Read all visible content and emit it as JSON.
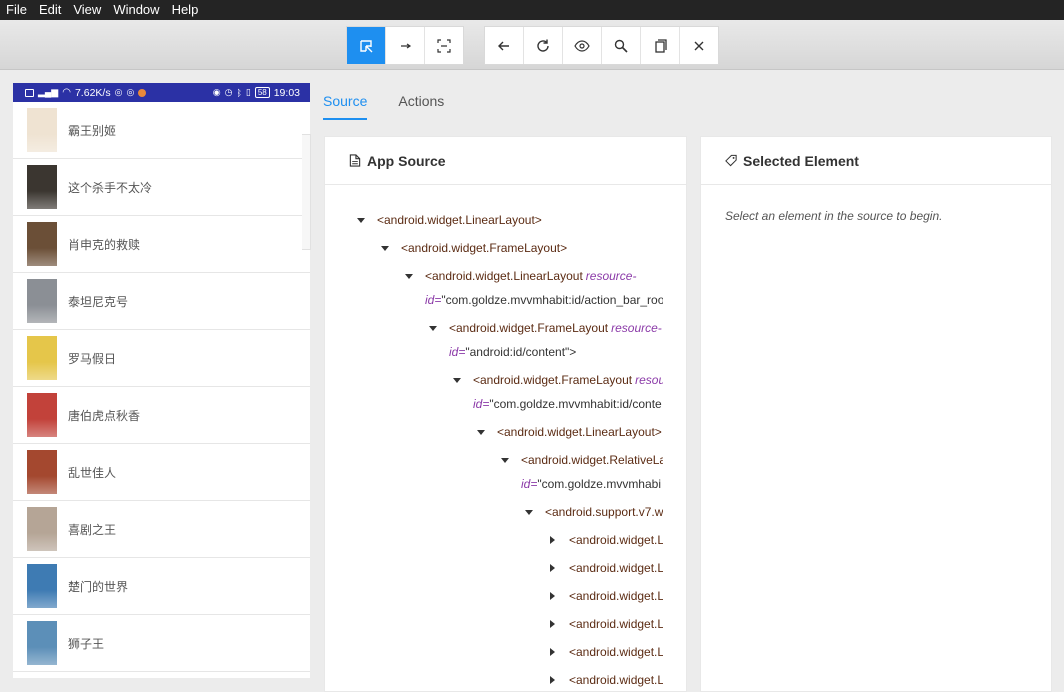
{
  "menu": [
    "File",
    "Edit",
    "View",
    "Window",
    "Help"
  ],
  "toolbar": {
    "left_group": [
      {
        "icon": "select-icon",
        "active": true
      },
      {
        "icon": "swipe-icon",
        "active": false
      },
      {
        "icon": "tap-coordinates-icon",
        "active": false
      }
    ],
    "right_group": [
      {
        "icon": "back-icon"
      },
      {
        "icon": "refresh-icon"
      },
      {
        "icon": "eye-icon"
      },
      {
        "icon": "search-icon"
      },
      {
        "icon": "copy-icon"
      },
      {
        "icon": "close-icon"
      }
    ]
  },
  "device": {
    "status_bar": {
      "network_speed": "7.62K/s",
      "battery": "58",
      "time": "19:03"
    },
    "movies": [
      {
        "title": "霸王别姬",
        "poster_color": "#efe3d2"
      },
      {
        "title": "这个杀手不太冷",
        "poster_color": "#3b3630"
      },
      {
        "title": "肖申克的救赎",
        "poster_color": "#6b4f37"
      },
      {
        "title": "泰坦尼克号",
        "poster_color": "#8b8f95"
      },
      {
        "title": "罗马假日",
        "poster_color": "#e5c64a"
      },
      {
        "title": "唐伯虎点秋香",
        "poster_color": "#c2423a"
      },
      {
        "title": "乱世佳人",
        "poster_color": "#a4482f"
      },
      {
        "title": "喜剧之王",
        "poster_color": "#b5a596"
      },
      {
        "title": "楚门的世界",
        "poster_color": "#3e7bb3"
      },
      {
        "title": "狮子王",
        "poster_color": "#5c8fb8"
      }
    ]
  },
  "tabs": [
    {
      "label": "Source",
      "active": true
    },
    {
      "label": "Actions",
      "active": false
    }
  ],
  "source_panel": {
    "title": "App Source",
    "nodes": [
      {
        "depth": 0,
        "expanded": true,
        "tag": "<android.widget.LinearLayout>"
      },
      {
        "depth": 1,
        "expanded": true,
        "tag": "<android.widget.FrameLayout>"
      },
      {
        "depth": 2,
        "expanded": true,
        "tag": "<android.widget.LinearLayout",
        "attr": "resource-",
        "cont_attr": "id=",
        "value": "\"com.goldze.mvvmhabit:id/action_bar_roo"
      },
      {
        "depth": 3,
        "expanded": true,
        "tag": "<android.widget.FrameLayout",
        "attr": "resource-",
        "cont_attr": "id=",
        "value": "\"android:id/content\">"
      },
      {
        "depth": 4,
        "expanded": true,
        "tag": "<android.widget.FrameLayout",
        "attr": "resou",
        "cont_attr": "id=",
        "value": "\"com.goldze.mvvmhabit:id/conte"
      },
      {
        "depth": 5,
        "expanded": true,
        "tag": "<android.widget.LinearLayout>"
      },
      {
        "depth": 6,
        "expanded": true,
        "tag": "<android.widget.RelativeLa",
        "cont_attr": "id=",
        "value": "\"com.goldze.mvvmhabi"
      },
      {
        "depth": 7,
        "expanded": true,
        "tag": "<android.support.v7.w"
      },
      {
        "depth": 8,
        "expanded": false,
        "tag": "<android.widget.L"
      },
      {
        "depth": 8,
        "expanded": false,
        "tag": "<android.widget.L"
      },
      {
        "depth": 8,
        "expanded": false,
        "tag": "<android.widget.L"
      },
      {
        "depth": 8,
        "expanded": false,
        "tag": "<android.widget.L"
      },
      {
        "depth": 8,
        "expanded": false,
        "tag": "<android.widget.L"
      },
      {
        "depth": 8,
        "expanded": false,
        "tag": "<android.widget.L"
      }
    ]
  },
  "selected_panel": {
    "title": "Selected Element",
    "placeholder": "Select an element in the source to begin."
  }
}
